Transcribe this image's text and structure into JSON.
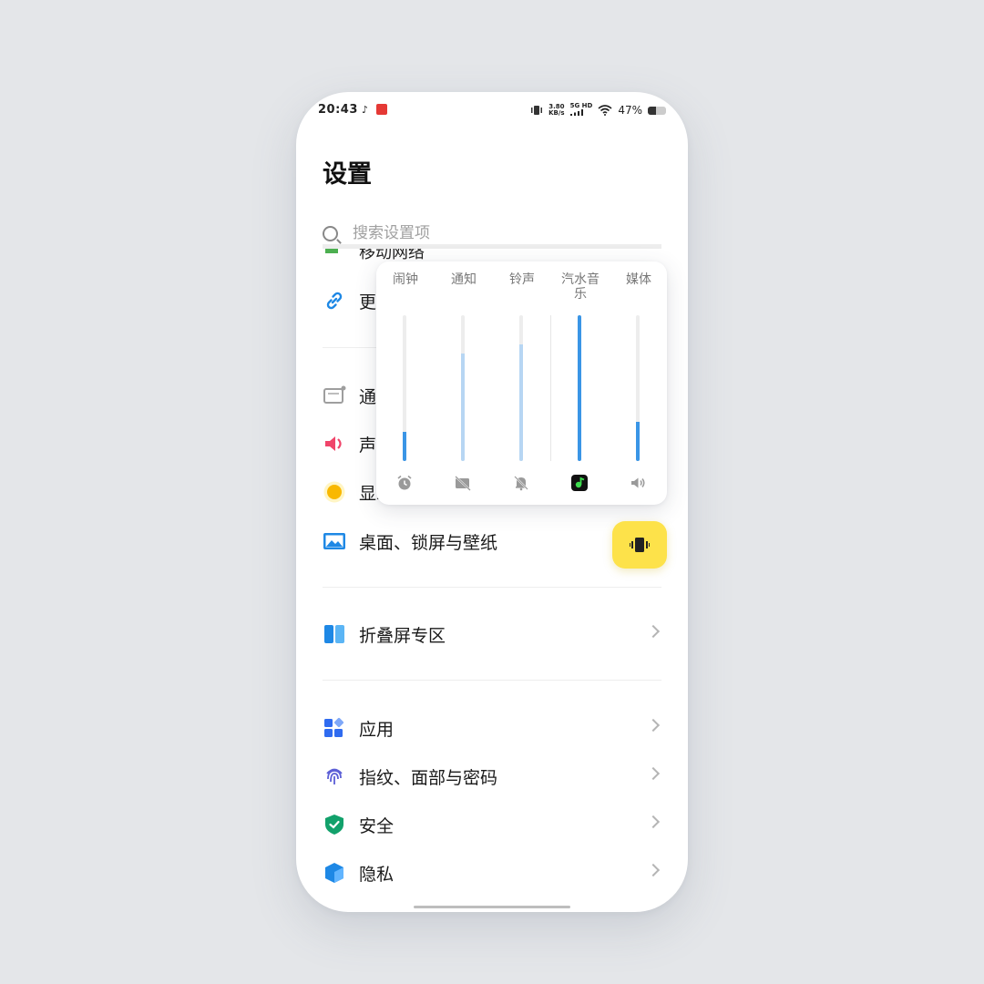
{
  "status_bar": {
    "time": "20:43",
    "net_speed_value": "3.80",
    "net_speed_unit": "KB/s",
    "signal_label": "5G HD",
    "battery_text": "47%",
    "battery_level": 0.47
  },
  "page": {
    "title": "设置"
  },
  "search": {
    "placeholder": "搜索设置项"
  },
  "settings": {
    "partial_label": "移动网络",
    "more_connections": "更多连接",
    "notifications": "通知与状态栏",
    "sound": "声音与振动",
    "display": "显示与亮度",
    "desktop": "桌面、锁屏与壁纸",
    "foldable": "折叠屏专区",
    "apps": "应用",
    "biometrics": "指纹、面部与密码",
    "security": "安全",
    "privacy": "隐私"
  },
  "volume_panel": {
    "channels": [
      {
        "label": "闹钟",
        "level": 0.2,
        "active": true,
        "icon": "alarm-clock-icon"
      },
      {
        "label": "通知",
        "level": 0.74,
        "active": false,
        "icon": "notification-muted-icon"
      },
      {
        "label": "铃声",
        "level": 0.8,
        "active": false,
        "icon": "bell-muted-icon"
      },
      {
        "label": "汽水音乐",
        "level": 1.0,
        "active": true,
        "icon": "qishui-music-app-icon"
      },
      {
        "label": "媒体",
        "level": 0.27,
        "active": true,
        "icon": "speaker-icon"
      }
    ],
    "ringer_mode": "vibrate-icon"
  },
  "colors": {
    "accent": "#3a95e6",
    "level_inactive": "#b7d6f3",
    "vibrate_button": "#fde24a"
  }
}
